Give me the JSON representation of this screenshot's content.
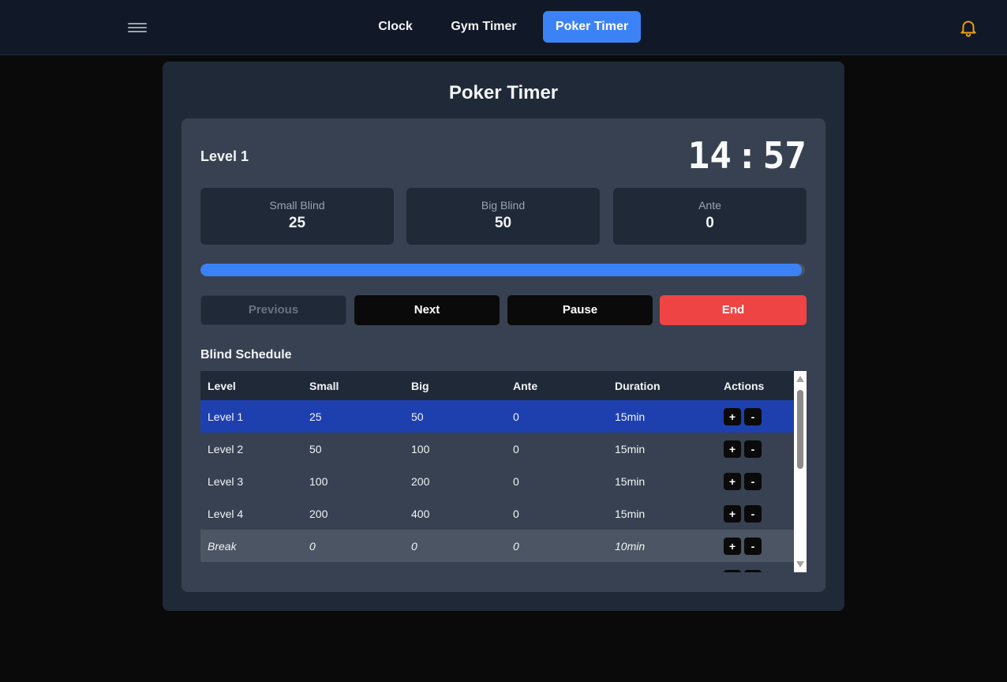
{
  "nav": {
    "menu_icon": "hamburger-menu-icon",
    "tabs": [
      {
        "label": "Clock",
        "active": false
      },
      {
        "label": "Gym Timer",
        "active": false
      },
      {
        "label": "Poker Timer",
        "active": true
      }
    ],
    "notification_icon": "bell-icon",
    "accent_color": "#3b82f6",
    "bell_color": "#f59e0b"
  },
  "page": {
    "title": "Poker Timer"
  },
  "timer": {
    "level_label": "Level 1",
    "minutes": "14",
    "separator": ":",
    "seconds": "57",
    "progress_fraction": 0.995
  },
  "blinds": {
    "small": {
      "label": "Small Blind",
      "value": "25"
    },
    "big": {
      "label": "Big Blind",
      "value": "50"
    },
    "ante": {
      "label": "Ante",
      "value": "0"
    }
  },
  "controls": {
    "previous_label": "Previous",
    "next_label": "Next",
    "pause_label": "Pause",
    "end_label": "End",
    "end_color": "#ef4444"
  },
  "schedule": {
    "title": "Blind Schedule",
    "columns": [
      "Level",
      "Small",
      "Big",
      "Ante",
      "Duration",
      "Actions"
    ],
    "rows": [
      {
        "level": "Level 1",
        "small": "25",
        "big": "50",
        "ante": "0",
        "duration": "15min",
        "type": "current"
      },
      {
        "level": "Level 2",
        "small": "50",
        "big": "100",
        "ante": "0",
        "duration": "15min",
        "type": "level"
      },
      {
        "level": "Level 3",
        "small": "100",
        "big": "200",
        "ante": "0",
        "duration": "15min",
        "type": "level"
      },
      {
        "level": "Level 4",
        "small": "200",
        "big": "400",
        "ante": "0",
        "duration": "15min",
        "type": "level"
      },
      {
        "level": "Break",
        "small": "0",
        "big": "0",
        "ante": "0",
        "duration": "10min",
        "type": "break"
      }
    ],
    "action_plus": "+",
    "action_minus": "-"
  }
}
